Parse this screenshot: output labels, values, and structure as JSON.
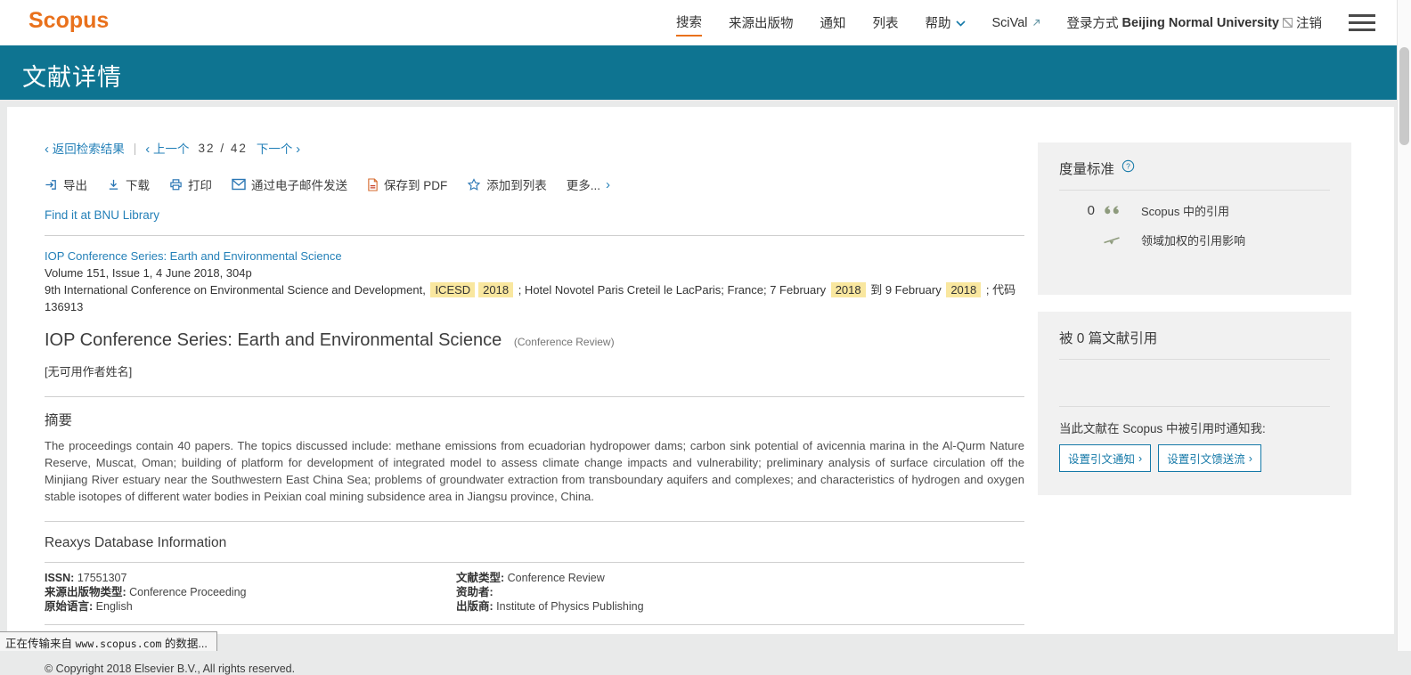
{
  "colors": {
    "accent_orange": "#e9711c",
    "banner_teal": "#0e7491",
    "link_blue": "#2480b8",
    "button_teal": "#1579a8",
    "highlight_yellow": "#f9e79f",
    "panel_gray": "#f1f1f1",
    "metric_icon_olive": "#8e9b7d"
  },
  "topbar": {
    "logo": "Scopus",
    "nav": [
      {
        "label": "搜索"
      },
      {
        "label": "来源出版物"
      },
      {
        "label": "通知"
      },
      {
        "label": "列表"
      },
      {
        "label": "帮助"
      },
      {
        "label": "SciVal"
      }
    ],
    "login_prefix": "登录方式",
    "institution": "Beijing Normal University",
    "logout": "注销"
  },
  "banner": {
    "title": "文献详情"
  },
  "record_nav": {
    "back": "返回检索结果",
    "prev": "上一个",
    "position": "32 / 42",
    "next": "下一个"
  },
  "toolbar": {
    "export": "导出",
    "download": "下载",
    "print": "打印",
    "email": "通过电子邮件发送",
    "pdf": "保存到 PDF",
    "add_to_list": "添加到列表",
    "more": "更多..."
  },
  "find_it": "Find it at BNU Library",
  "source": {
    "title_link": "IOP Conference Series: Earth and Environmental Science",
    "volume_line": "Volume 151, Issue 1, 4 June 2018, 304p",
    "conference": {
      "part1": "9th International Conference on Environmental Science and Development, ",
      "hl1": "ICESD",
      "hl2": "2018",
      "part2": " ; Hotel Novotel Paris Creteil le LacParis; France; 7 February ",
      "hl3": "2018",
      "part3": " 到 9 February ",
      "hl4": "2018",
      "part4": " ; 代码 136913"
    }
  },
  "document": {
    "title": "IOP Conference Series: Earth and Environmental Science",
    "type_note": "(Conference Review)",
    "authors_note": "[无可用作者姓名]"
  },
  "abstract": {
    "heading": "摘要",
    "text": "The proceedings contain 40 papers. The topics discussed include: methane emissions from ecuadorian hydropower dams; carbon sink potential of avicennia marina in the Al-Qurm Nature Reserve, Muscat, Oman; building of platform for development of integrated model to assess climate change impacts and vulnerability; preliminary analysis of surface circulation off the Minjiang River estuary near the Southwestern East China Sea; problems of groundwater extraction from transboundary aquifers and complexes; and characteristics of hydrogen and oxygen stable isotopes of different water bodies in Peixian coal mining subsidence area in Jiangsu province, China."
  },
  "reaxys_heading": "Reaxys Database Information",
  "details": {
    "left": [
      {
        "label": "ISSN:",
        "value": "17551307"
      },
      {
        "label": "来源出版物类型:",
        "value": "Conference Proceeding"
      },
      {
        "label": "原始语言:",
        "value": "English"
      }
    ],
    "right": [
      {
        "label": "文献类型:",
        "value": "Conference Review"
      },
      {
        "label": "资助者:",
        "value": ""
      },
      {
        "label": "出版商:",
        "value": "Institute of Physics Publishing"
      }
    ]
  },
  "copyright": "© Copyright 2018 Elsevier B.V., All rights reserved.",
  "metrics": {
    "heading": "度量标准",
    "citation_count": "0",
    "citation_label": "Scopus 中的引用",
    "fwci_label": "领域加权的引用影响"
  },
  "cited_by": {
    "heading": "被 0 篇文献引用",
    "inform_text": "当此文献在 Scopus 中被引用时通知我:",
    "set_alert_button": "设置引文通知",
    "set_feed_button": "设置引文馈送流"
  },
  "statusbar": {
    "prefix": "正在传输来自 ",
    "url": "www.scopus.com",
    "suffix": " 的数据..."
  }
}
